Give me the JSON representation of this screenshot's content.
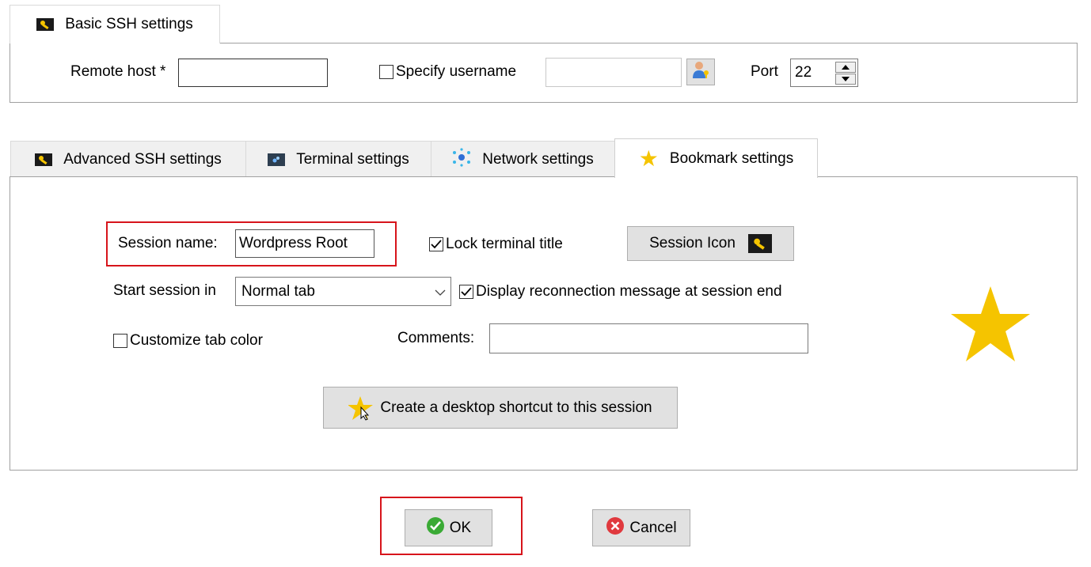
{
  "basic_tab": {
    "label": "Basic SSH settings",
    "remote_host_label": "Remote host *",
    "remote_host_value": "",
    "specify_username_label": "Specify username",
    "specify_username_checked": false,
    "username_value": "",
    "port_label": "Port",
    "port_value": "22"
  },
  "tabs": [
    {
      "label": "Advanced SSH settings",
      "icon": "key-icon"
    },
    {
      "label": "Terminal settings",
      "icon": "terminal-icon"
    },
    {
      "label": "Network settings",
      "icon": "network-icon"
    },
    {
      "label": "Bookmark settings",
      "icon": "star-icon",
      "active": true
    }
  ],
  "bookmark": {
    "session_name_label": "Session name:",
    "session_name_value": "Wordpress Root",
    "lock_title_label": "Lock terminal title",
    "lock_title_checked": true,
    "session_icon_button": "Session Icon",
    "start_session_label": "Start session in",
    "start_session_value": "Normal tab",
    "display_reconnect_label": "Display reconnection message at session end",
    "display_reconnect_checked": true,
    "customize_tab_color_label": "Customize tab color",
    "customize_tab_color_checked": false,
    "comments_label": "Comments:",
    "comments_value": "",
    "shortcut_button": "Create a desktop shortcut to this session"
  },
  "footer": {
    "ok_label": "OK",
    "cancel_label": "Cancel"
  },
  "colors": {
    "star": "#f5c400",
    "highlight": "#d7141b",
    "ok_green": "#3aaa35",
    "cancel_red": "#e0393e"
  }
}
